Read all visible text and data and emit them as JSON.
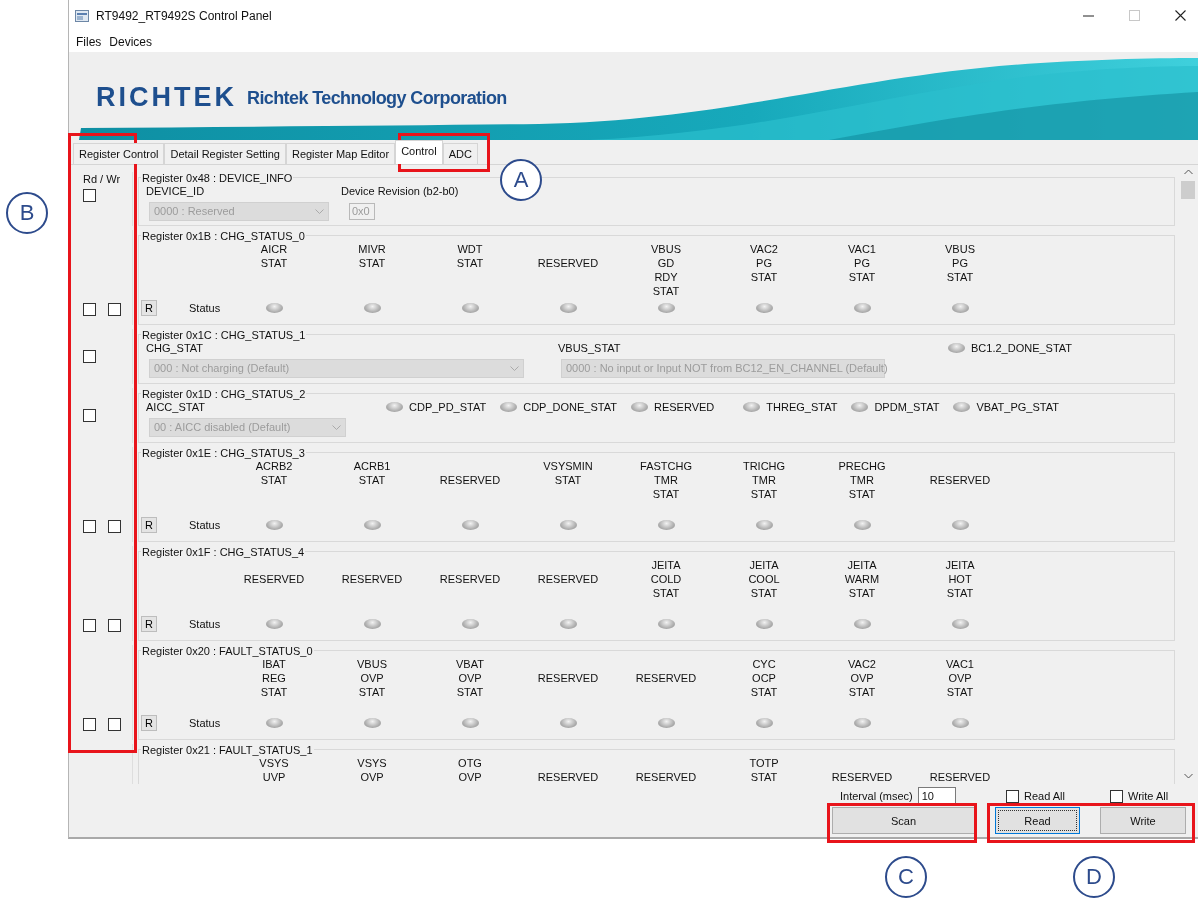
{
  "window": {
    "title": "RT9492_RT9492S Control Panel",
    "maximize_disabled": true
  },
  "menu": [
    {
      "label": "Files"
    },
    {
      "label": "Devices"
    }
  ],
  "banner": {
    "logo": "RICHTEK",
    "company": "Richtek Technology Corporation"
  },
  "tabs": [
    {
      "label": "Register Control",
      "selected": false
    },
    {
      "label": "Detail Register Setting",
      "selected": false
    },
    {
      "label": "Register Map Editor",
      "selected": false
    },
    {
      "label": "Control",
      "selected": true
    },
    {
      "label": "ADC",
      "selected": false
    }
  ],
  "rw_header": "Rd / Wr",
  "registers": [
    {
      "kind": "fields",
      "title": "Register 0x48 : DEVICE_INFO",
      "rd": false,
      "fields": [
        {
          "kind": "select",
          "label": "DEVICE_ID",
          "value": "0000 : Reserved",
          "disabled": true
        },
        {
          "kind": "text",
          "label": "Device Revision (b2-b0)",
          "value": "0x0",
          "disabled": true
        }
      ]
    },
    {
      "kind": "status",
      "title": "Register 0x1B : CHG_STATUS_0",
      "rd": false,
      "wr": false,
      "button": "R",
      "status_label": "Status",
      "bits": [
        {
          "label": "AICR\nSTAT",
          "on": false
        },
        {
          "label": "MIVR\nSTAT",
          "on": false
        },
        {
          "label": "WDT\nSTAT",
          "on": false
        },
        {
          "label": "RESERVED",
          "on": false
        },
        {
          "label": "VBUS\nGD\nRDY\nSTAT",
          "on": false
        },
        {
          "label": "VAC2\nPG\nSTAT",
          "on": false
        },
        {
          "label": "VAC1\nPG\nSTAT",
          "on": false
        },
        {
          "label": "VBUS\nPG\nSTAT",
          "on": false
        }
      ]
    },
    {
      "kind": "fields",
      "title": "Register 0x1C : CHG_STATUS_1",
      "rd": false,
      "fields": [
        {
          "kind": "select",
          "label": "CHG_STAT",
          "value": "000 : Not charging (Default)",
          "disabled": true
        },
        {
          "kind": "select",
          "label": "VBUS_STAT",
          "value": "0000 : No input or Input NOT from BC12_EN_CHANNEL (Default)",
          "disabled": true
        },
        {
          "kind": "flag",
          "label": "BC1.2_DONE_STAT",
          "on": false
        }
      ]
    },
    {
      "kind": "fields",
      "title": "Register 0x1D : CHG_STATUS_2",
      "rd": false,
      "fields": [
        {
          "kind": "select",
          "label": "AICC_STAT",
          "value": "00 : AICC disabled (Default)",
          "disabled": true
        },
        {
          "kind": "flag",
          "label": "CDP_PD_STAT",
          "on": false
        },
        {
          "kind": "flag",
          "label": "CDP_DONE_STAT",
          "on": false
        },
        {
          "kind": "flag",
          "label": "RESERVED",
          "on": false
        },
        {
          "kind": "flag",
          "label": "THREG_STAT",
          "on": false
        },
        {
          "kind": "flag",
          "label": "DPDM_STAT",
          "on": false
        },
        {
          "kind": "flag",
          "label": "VBAT_PG_STAT",
          "on": false
        }
      ]
    },
    {
      "kind": "status",
      "title": "Register 0x1E : CHG_STATUS_3",
      "rd": false,
      "wr": false,
      "button": "R",
      "status_label": "Status",
      "bits": [
        {
          "label": "ACRB2\nSTAT",
          "on": false
        },
        {
          "label": "ACRB1\nSTAT",
          "on": false
        },
        {
          "label": "RESERVED",
          "on": false
        },
        {
          "label": "VSYSMIN\nSTAT",
          "on": false
        },
        {
          "label": "FASTCHG\nTMR\nSTAT",
          "on": false
        },
        {
          "label": "TRICHG\nTMR\nSTAT",
          "on": false
        },
        {
          "label": "PRECHG\nTMR\nSTAT",
          "on": false
        },
        {
          "label": "RESERVED",
          "on": false
        }
      ]
    },
    {
      "kind": "status",
      "title": "Register 0x1F : CHG_STATUS_4",
      "rd": false,
      "wr": false,
      "button": "R",
      "status_label": "Status",
      "bits": [
        {
          "label": "RESERVED",
          "on": false
        },
        {
          "label": "RESERVED",
          "on": false
        },
        {
          "label": "RESERVED",
          "on": false
        },
        {
          "label": "RESERVED",
          "on": false
        },
        {
          "label": "JEITA\nCOLD\nSTAT",
          "on": false
        },
        {
          "label": "JEITA\nCOOL\nSTAT",
          "on": false
        },
        {
          "label": "JEITA\nWARM\nSTAT",
          "on": false
        },
        {
          "label": "JEITA\nHOT\nSTAT",
          "on": false
        }
      ]
    },
    {
      "kind": "status",
      "title": "Register 0x20 : FAULT_STATUS_0",
      "rd": false,
      "wr": false,
      "button": "R",
      "status_label": "Status",
      "bits": [
        {
          "label": "IBAT\nREG\nSTAT",
          "on": false
        },
        {
          "label": "VBUS\nOVP\nSTAT",
          "on": false
        },
        {
          "label": "VBAT\nOVP\nSTAT",
          "on": false
        },
        {
          "label": "RESERVED",
          "on": false
        },
        {
          "label": "RESERVED",
          "on": false
        },
        {
          "label": "CYC\nOCP\nSTAT",
          "on": false
        },
        {
          "label": "VAC2\nOVP\nSTAT",
          "on": false
        },
        {
          "label": "VAC1\nOVP\nSTAT",
          "on": false
        }
      ]
    },
    {
      "kind": "status",
      "title": "Register 0x21 : FAULT_STATUS_1",
      "bits": [
        {
          "label": "VSYS\nUVP"
        },
        {
          "label": "VSYS\nOVP"
        },
        {
          "label": "OTG\nOVP"
        },
        {
          "label": "RESERVED"
        },
        {
          "label": "RESERVED"
        },
        {
          "label": "TOTP\nSTAT"
        },
        {
          "label": "RESERVED"
        },
        {
          "label": "RESERVED"
        }
      ]
    }
  ],
  "interval": {
    "label": "Interval (msec)",
    "value": "10"
  },
  "read_all": {
    "label": "Read All",
    "checked": false
  },
  "write_all": {
    "label": "Write All",
    "checked": false
  },
  "buttons": [
    {
      "label": "Scan",
      "focused": false
    },
    {
      "label": "Read",
      "focused": true
    },
    {
      "label": "Write",
      "focused": false
    }
  ],
  "callouts": [
    {
      "label": "A"
    },
    {
      "label": "B"
    },
    {
      "label": "C"
    },
    {
      "label": "D"
    }
  ]
}
